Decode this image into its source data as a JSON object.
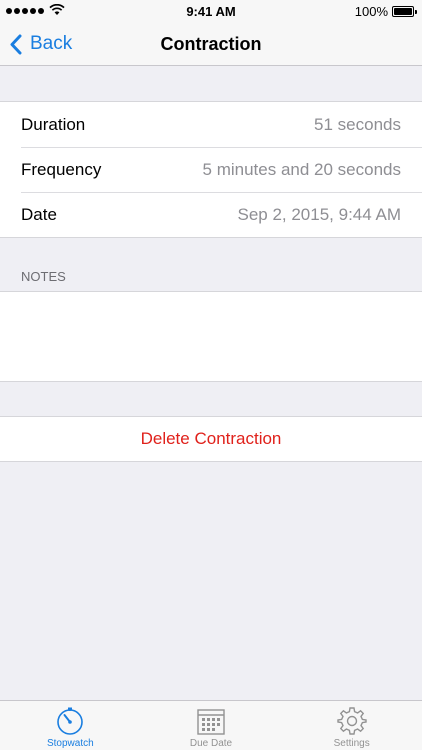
{
  "status_bar": {
    "time": "9:41 AM",
    "battery": "100%",
    "signal_icon": "signal-dots-icon",
    "wifi_icon": "wifi-icon",
    "battery_icon": "battery-icon"
  },
  "nav": {
    "back_label": "Back",
    "title": "Contraction",
    "accent_color": "#1a7ee0"
  },
  "details": [
    {
      "label": "Duration",
      "value": "51 seconds"
    },
    {
      "label": "Frequency",
      "value": "5 minutes and 20 seconds"
    },
    {
      "label": "Date",
      "value": "Sep 2, 2015, 9:44 AM"
    }
  ],
  "notes": {
    "header": "NOTES",
    "value": ""
  },
  "delete_label": "Delete Contraction",
  "delete_color": "#e0211b",
  "tabs": [
    {
      "label": "Stopwatch",
      "icon": "stopwatch-icon",
      "active": true
    },
    {
      "label": "Due Date",
      "icon": "calendar-icon",
      "active": false
    },
    {
      "label": "Settings",
      "icon": "gear-icon",
      "active": false
    }
  ]
}
